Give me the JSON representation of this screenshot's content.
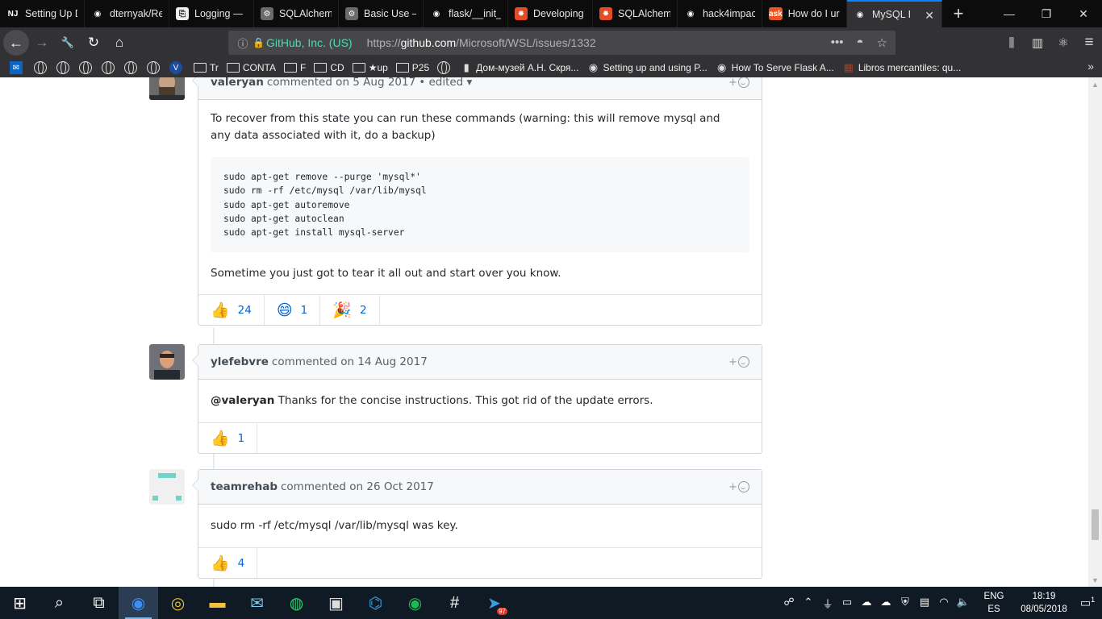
{
  "browser": {
    "tabs": [
      {
        "title": "Setting Up Da",
        "favicon": "nj-icon",
        "fav_text": "NJ",
        "fav_color": "#0c0c0d"
      },
      {
        "title": "dternyak/Re",
        "favicon": "github-icon",
        "fav_text": "◉",
        "fav_color": "#0c0c0d"
      },
      {
        "title": "Logging — ",
        "favicon": "doc-icon",
        "fav_text": "⎘",
        "fav_color": "#f0f0f0"
      },
      {
        "title": "SQLAlchem",
        "favicon": "gear-icon",
        "fav_text": "⚙",
        "fav_color": "#6b6b6b"
      },
      {
        "title": "Basic Use –",
        "favicon": "gear-icon",
        "fav_text": "⚙",
        "fav_color": "#6b6b6b"
      },
      {
        "title": "flask/__init_",
        "favicon": "github-icon",
        "fav_text": "◉",
        "fav_color": "#0c0c0d"
      },
      {
        "title": "Developing",
        "favicon": "red-gear-icon",
        "fav_text": "✹",
        "fav_color": "#e34c26"
      },
      {
        "title": "SQLAlchem",
        "favicon": "red-gear-icon",
        "fav_text": "✹",
        "fav_color": "#e34c26"
      },
      {
        "title": "hack4impac",
        "favicon": "github-icon",
        "fav_text": "◉",
        "fav_color": "#0c0c0d"
      },
      {
        "title": "How do I ur",
        "favicon": "ask-icon",
        "fav_text": "ask",
        "fav_color": "#e95420"
      },
      {
        "title": "MySQL I",
        "favicon": "github-icon",
        "fav_text": "◉",
        "fav_color": "#323234",
        "active": true
      }
    ],
    "new_tab_label": "+",
    "window": {
      "minimize": "—",
      "restore": "❐",
      "close": "✕"
    },
    "url": {
      "identity": "GitHub, Inc. (US)",
      "scheme": "https://",
      "domain": "github.com",
      "path": "/Microsoft/WSL/issues/1332"
    },
    "nav_icons": {
      "back": "←",
      "forward": "→",
      "tools": "🔧",
      "reload": "↻",
      "home": "⌂",
      "more": "•••",
      "pocket": "◓",
      "star": "☆",
      "library": "⫼",
      "sidebar": "▥",
      "react": "⚛",
      "menu": "≡"
    },
    "bookmarks": [
      {
        "label": "",
        "icon": "outlook-icon",
        "glyph": "✉"
      },
      {
        "label": "",
        "icon": "globe-icon"
      },
      {
        "label": "",
        "icon": "globe-icon"
      },
      {
        "label": "",
        "icon": "globe-icon"
      },
      {
        "label": "",
        "icon": "globe-icon"
      },
      {
        "label": "",
        "icon": "globe-icon"
      },
      {
        "label": "",
        "icon": "globe-icon"
      },
      {
        "label": "",
        "icon": "v-icon",
        "glyph": "V"
      },
      {
        "label": "Tr",
        "icon": "folder-icon"
      },
      {
        "label": "CONTA",
        "icon": "folder-icon"
      },
      {
        "label": "F",
        "icon": "folder-icon"
      },
      {
        "label": "CD",
        "icon": "folder-icon"
      },
      {
        "label": "★up",
        "icon": "folder-icon"
      },
      {
        "label": "P25",
        "icon": "folder-icon"
      },
      {
        "label": "",
        "icon": "globe-icon"
      },
      {
        "label": "Дом-музей А.Н. Скря...",
        "icon": "barcode-icon",
        "glyph": "▮"
      },
      {
        "label": "Setting up and using P...",
        "icon": "github-icon",
        "glyph": "◉"
      },
      {
        "label": "How To Serve Flask A...",
        "icon": "github-icon",
        "glyph": "◉"
      },
      {
        "label": "Libros mercantiles: qu...",
        "icon": "book-icon",
        "glyph": "▦"
      }
    ],
    "bookmarks_more": "»"
  },
  "comments": [
    {
      "author": "valeryan",
      "action": "commented on 5 Aug 2017",
      "edited": "• edited ▾",
      "react_plus": "+",
      "paragraphs": [
        "To recover from this state you can run these commands (warning: this will remove mysql and any data associated with it, do a backup)"
      ],
      "code": [
        "sudo apt-get remove --purge 'mysql*'",
        "sudo rm -rf /etc/mysql /var/lib/mysql",
        "sudo apt-get autoremove",
        "sudo apt-get autoclean",
        "sudo apt-get install mysql-server"
      ],
      "after_code": "Sometime you just got to tear it all out and start over you know.",
      "reactions": [
        {
          "emoji": "👍",
          "count": "24",
          "name": "thumbs-up-icon"
        },
        {
          "emoji": "😄",
          "count": "1",
          "name": "laugh-icon"
        },
        {
          "emoji": "🎉",
          "count": "2",
          "name": "hooray-icon"
        }
      ]
    },
    {
      "author": "ylefebvre",
      "action": "commented on 14 Aug 2017",
      "react_plus": "+",
      "mention": "@valeryan",
      "text": " Thanks for the concise instructions. This got rid of the update errors.",
      "reactions": [
        {
          "emoji": "👍",
          "count": "1",
          "name": "thumbs-up-icon"
        }
      ]
    },
    {
      "author": "teamrehab",
      "action": "commented on 26 Oct 2017",
      "react_plus": "+",
      "text": "sudo rm -rf /etc/mysql /var/lib/mysql was key.",
      "reactions": [
        {
          "emoji": "👍",
          "count": "4",
          "name": "thumbs-up-icon"
        }
      ]
    }
  ],
  "taskbar": {
    "apps": [
      {
        "name": "start-icon",
        "glyph": "⊞"
      },
      {
        "name": "search-icon",
        "glyph": "⌕"
      },
      {
        "name": "task-view-icon",
        "glyph": "⧉"
      },
      {
        "name": "firefox-icon",
        "glyph": "◉",
        "color": "#3d8ff5",
        "active": true
      },
      {
        "name": "chrome-icon",
        "glyph": "◎",
        "color": "#e8c12a"
      },
      {
        "name": "file-explorer-icon",
        "glyph": "▬",
        "color": "#f3c23c"
      },
      {
        "name": "mail-icon",
        "glyph": "✉",
        "color": "#7ecbe9"
      },
      {
        "name": "whatsapp-icon",
        "glyph": "◍",
        "color": "#25d366"
      },
      {
        "name": "terminal-icon",
        "glyph": "▣",
        "color": "#dddddd"
      },
      {
        "name": "vscode-icon",
        "glyph": "⌬",
        "color": "#3a9bdc"
      },
      {
        "name": "spotify-icon",
        "glyph": "◉",
        "color": "#1db954"
      },
      {
        "name": "slack-icon",
        "glyph": "#",
        "color": "#ffffff"
      },
      {
        "name": "telegram-icon",
        "glyph": "➤",
        "color": "#3a9de0",
        "badge": "97"
      }
    ],
    "tray_icons": [
      {
        "name": "people-icon",
        "glyph": "☍"
      },
      {
        "name": "chevron-up-icon",
        "glyph": "⌃"
      },
      {
        "name": "usb-icon",
        "glyph": "⏚"
      },
      {
        "name": "network-icon",
        "glyph": "▭"
      },
      {
        "name": "cloud-icon",
        "glyph": "☁"
      },
      {
        "name": "onedrive-icon",
        "glyph": "☁"
      },
      {
        "name": "defender-icon",
        "glyph": "⛨"
      },
      {
        "name": "monitor-icon",
        "glyph": "▤"
      },
      {
        "name": "wifi-icon",
        "glyph": "◠"
      },
      {
        "name": "volume-icon",
        "glyph": "🔈"
      }
    ],
    "lang_top": "ENG",
    "lang_bottom": "ES",
    "time": "18:19",
    "date": "08/05/2018",
    "notifications_badge": "1"
  }
}
